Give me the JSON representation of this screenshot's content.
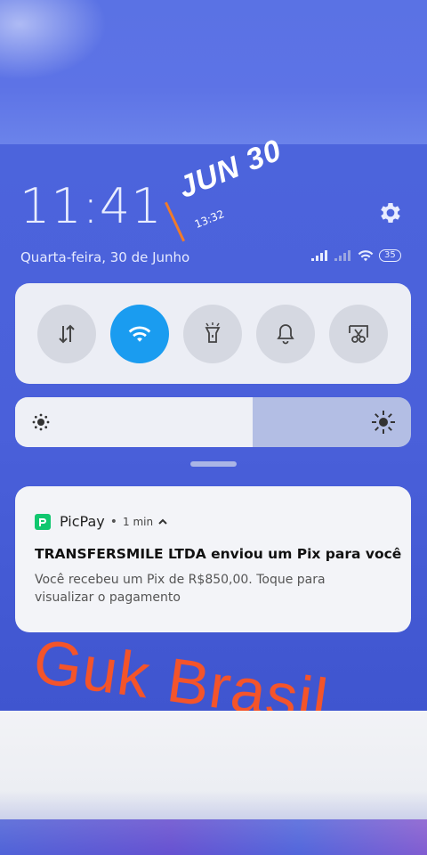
{
  "status": {
    "time": "11:41",
    "date": "Quarta-feira, 30 de Junho",
    "battery": "35"
  },
  "overlay": {
    "date_stamp": "JUN 30",
    "time_stamp": "13:32",
    "accent_color": "#f07b2a"
  },
  "quick_settings": {
    "tiles": [
      {
        "name": "mobile-data",
        "icon": "data-arrows-icon",
        "active": false
      },
      {
        "name": "wifi",
        "icon": "wifi-icon",
        "active": true
      },
      {
        "name": "flashlight",
        "icon": "flashlight-icon",
        "active": false
      },
      {
        "name": "sound",
        "icon": "bell-icon",
        "active": false
      },
      {
        "name": "screenshot",
        "icon": "scissors-icon",
        "active": false
      }
    ],
    "active_color": "#1a9cf0"
  },
  "brightness": {
    "level_percent": 60
  },
  "notification": {
    "app": "PicPay",
    "separator": "•",
    "time": "1 min",
    "title": "TRANSFERSMILE LTDA enviou um Pix para você",
    "body": "Você recebeu um Pix de R$850,00. Toque para visualizar o pagamento",
    "brand_color": "#11c76f"
  },
  "watermark": {
    "text": "Guk Brasil"
  }
}
